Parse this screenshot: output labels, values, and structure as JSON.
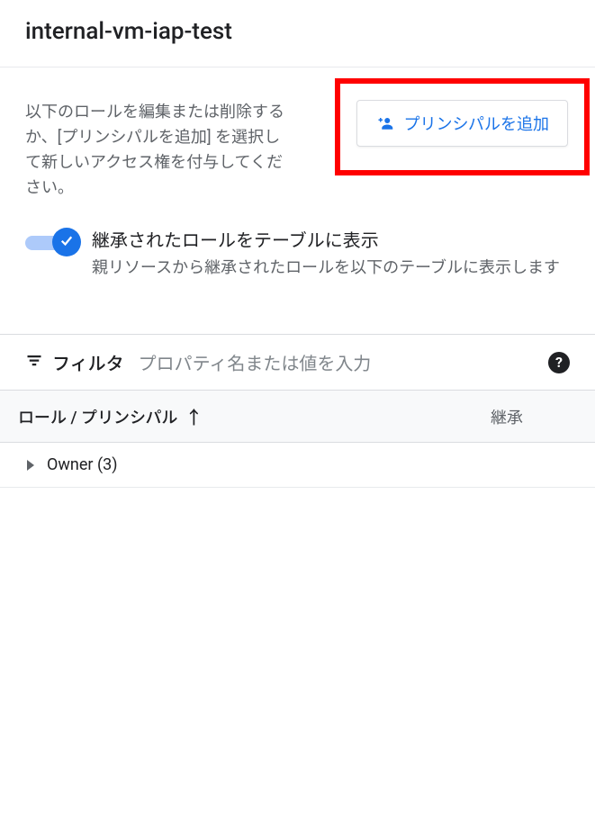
{
  "header": {
    "title": "internal-vm-iap-test"
  },
  "top": {
    "description": "以下のロールを編集または削除するか、[プリンシパルを追加] を選択して新しいアクセス権を付与してください。",
    "add_principal_label": "プリンシパルを追加"
  },
  "toggle": {
    "on": true,
    "title": "継承されたロールをテーブルに表示",
    "subtitle": "親リソースから継承されたロールを以下のテーブルに表示します"
  },
  "filter": {
    "label": "フィルタ",
    "placeholder": "プロパティ名または値を入力"
  },
  "table": {
    "col_role": "ロール / プリンシパル",
    "col_inherit": "継承",
    "rows": [
      {
        "label": "Owner (3)"
      }
    ]
  }
}
